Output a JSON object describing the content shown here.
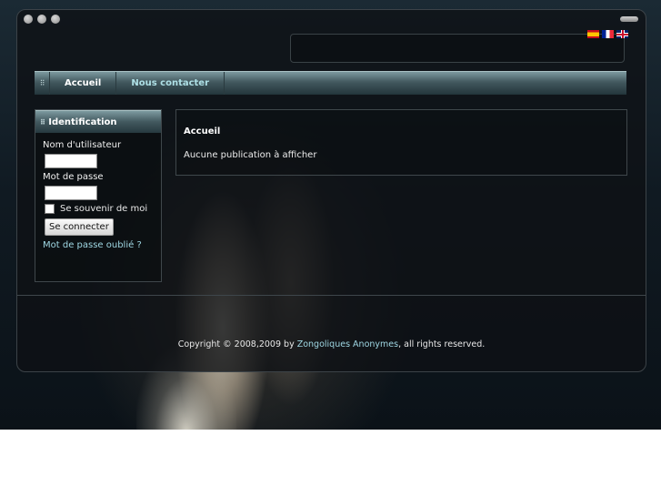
{
  "header": {
    "languages": [
      {
        "name": "flag-es-icon"
      },
      {
        "name": "flag-fr-icon"
      },
      {
        "name": "flag-gb-icon"
      }
    ]
  },
  "nav": {
    "items": [
      {
        "label": "Accueil"
      },
      {
        "label": "Nous contacter"
      }
    ]
  },
  "login": {
    "title": "Identification",
    "username_label": "Nom d'utilisateur",
    "username_value": "",
    "password_label": "Mot de passe",
    "password_value": "",
    "remember_label": "Se souvenir de moi",
    "submit_label": "Se connecter",
    "forgot_label": "Mot de passe oublié ?"
  },
  "main": {
    "title": "Accueil",
    "empty_message": "Aucune publication à afficher"
  },
  "footer": {
    "prefix": "Copyright © 2008,2009 by ",
    "owner": "Zongoliques Anonymes",
    "suffix": ", all rights reserved."
  },
  "colors": {
    "accent_link": "#9fd7e3",
    "nav_bar": "#42585e"
  }
}
